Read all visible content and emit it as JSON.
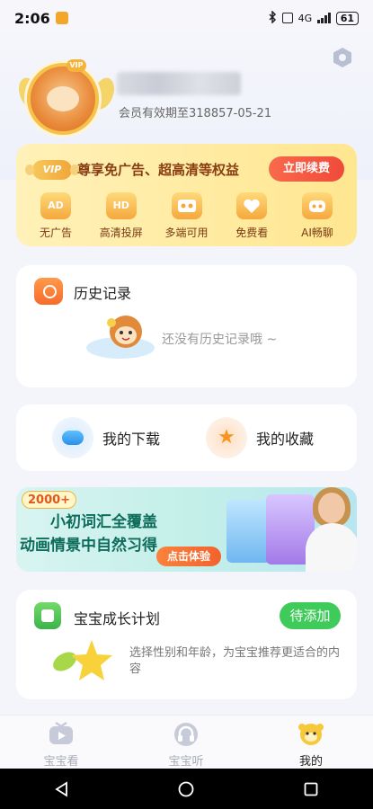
{
  "status_bar": {
    "time": "2:06",
    "network": "4G",
    "battery": "61"
  },
  "profile": {
    "membership_expiry": "会员有效期至318857-05-21",
    "avatar_badge": "VIP"
  },
  "vip": {
    "badge": "VIP",
    "title": "尊享免广告、超高清等权益",
    "renew_label": "立即续费",
    "features": [
      {
        "icon_text": "AD",
        "label": "无广告",
        "icon": "no-ads-icon"
      },
      {
        "icon_text": "HD",
        "label": "高清投屏",
        "icon": "hd-cast-icon"
      },
      {
        "icon_text": "",
        "label": "多端可用",
        "icon": "multi-device-icon"
      },
      {
        "icon_text": "",
        "label": "免费看",
        "icon": "free-watch-icon"
      },
      {
        "icon_text": "",
        "label": "AI畅聊",
        "icon": "ai-chat-icon"
      }
    ]
  },
  "history": {
    "title": "历史记录",
    "empty_text": "还没有历史记录哦 ~"
  },
  "shortcuts": {
    "download": "我的下载",
    "favorites": "我的收藏"
  },
  "banner": {
    "pill": "2000+",
    "line1": "小初词汇全覆盖",
    "line2": "动画情景中自然习得",
    "cta": "点击体验"
  },
  "growth": {
    "title": "宝宝成长计划",
    "add_label": "待添加",
    "description": "选择性别和年龄，为宝宝推荐更适合的内容"
  },
  "tabs": [
    {
      "label": "宝宝看",
      "active": false
    },
    {
      "label": "宝宝听",
      "active": false
    },
    {
      "label": "我的",
      "active": true
    }
  ],
  "colors": {
    "accent_orange": "#f04a3a",
    "accent_green": "#3ecb5a",
    "vip_gold": "#ffe690"
  }
}
